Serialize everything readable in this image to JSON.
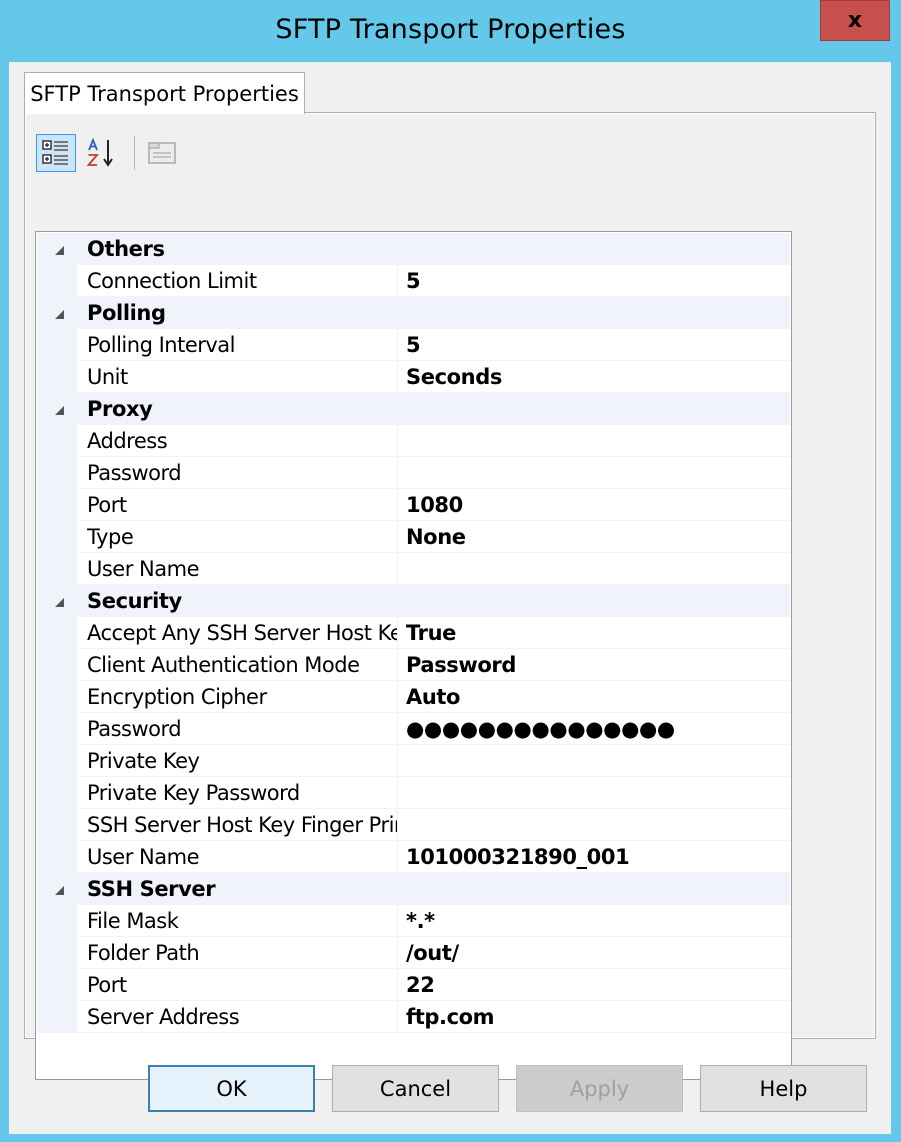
{
  "window": {
    "title": "SFTP Transport Properties",
    "close_glyph": "x"
  },
  "tab": {
    "label": "SFTP Transport Properties"
  },
  "toolbar": {
    "icons": [
      "categorized-icon",
      "alphabetical-icon",
      "property-pages-icon"
    ]
  },
  "grid": {
    "categories": [
      {
        "label": "Others",
        "rows": [
          {
            "name": "Connection Limit",
            "value": "5"
          }
        ]
      },
      {
        "label": "Polling",
        "rows": [
          {
            "name": "Polling Interval",
            "value": "5"
          },
          {
            "name": "Unit",
            "value": "Seconds"
          }
        ]
      },
      {
        "label": "Proxy",
        "rows": [
          {
            "name": "Address",
            "value": ""
          },
          {
            "name": "Password",
            "value": ""
          },
          {
            "name": "Port",
            "value": "1080"
          },
          {
            "name": "Type",
            "value": "None"
          },
          {
            "name": "User Name",
            "value": ""
          }
        ]
      },
      {
        "label": "Security",
        "rows": [
          {
            "name": "Accept Any SSH Server Host Ke",
            "value": "True"
          },
          {
            "name": "Client Authentication Mode",
            "value": "Password"
          },
          {
            "name": "Encryption Cipher",
            "value": "Auto"
          },
          {
            "name": "Password",
            "value": "●●●●●●●●●●●●●●●"
          },
          {
            "name": "Private Key",
            "value": ""
          },
          {
            "name": "Private Key Password",
            "value": ""
          },
          {
            "name": "SSH Server Host Key Finger Prin",
            "value": ""
          },
          {
            "name": "User Name",
            "value": "101000321890_001"
          }
        ]
      },
      {
        "label": "SSH Server",
        "rows": [
          {
            "name": "File Mask",
            "value": "*.*"
          },
          {
            "name": "Folder Path",
            "value": "/out/"
          },
          {
            "name": "Port",
            "value": "22"
          },
          {
            "name": "Server Address",
            "value": "ftp.com"
          }
        ]
      }
    ]
  },
  "buttons": {
    "ok": "OK",
    "cancel": "Cancel",
    "apply": "Apply",
    "help": "Help"
  },
  "colors": {
    "title_bar": "#63c8e9",
    "close": "#c7504c",
    "category_bg": "#f0f3f9"
  }
}
